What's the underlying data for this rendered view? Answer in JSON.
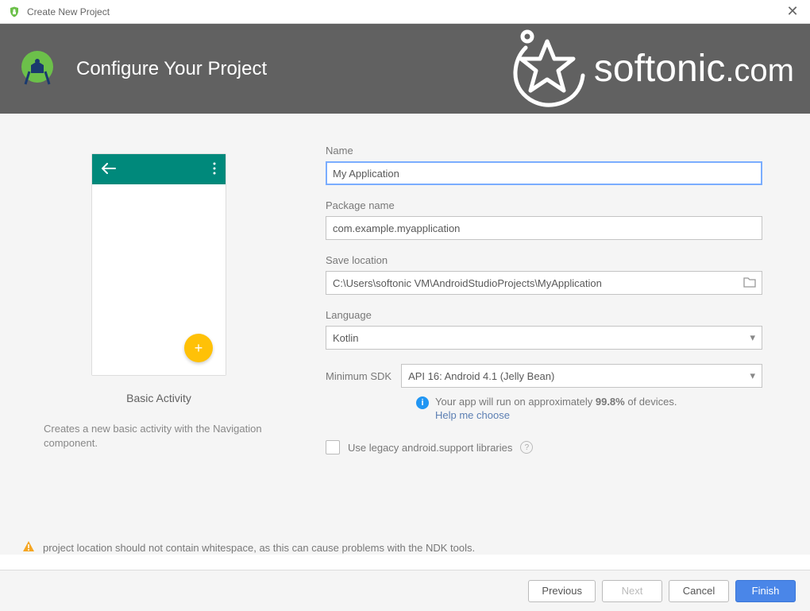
{
  "window": {
    "title": "Create New Project"
  },
  "header": {
    "title": "Configure Your Project"
  },
  "watermark": {
    "text": "softonic",
    "suffix": ".com"
  },
  "preview": {
    "activity_name": "Basic Activity",
    "description": "Creates a new basic activity with the Navigation component."
  },
  "form": {
    "name_label": "Name",
    "name_value": "My Application",
    "package_label": "Package name",
    "package_value": "com.example.myapplication",
    "location_label": "Save location",
    "location_value": "C:\\Users\\softonic VM\\AndroidStudioProjects\\MyApplication",
    "language_label": "Language",
    "language_value": "Kotlin",
    "sdk_label": "Minimum SDK",
    "sdk_value": "API 16: Android 4.1 (Jelly Bean)",
    "coverage_prefix": "Your app will run on approximately ",
    "coverage_percent": "99.8%",
    "coverage_suffix": " of devices.",
    "help_link": "Help me choose",
    "legacy_label": "Use legacy android.support libraries"
  },
  "warning": {
    "text": "project location should not contain whitespace, as this can cause problems with the NDK tools."
  },
  "buttons": {
    "previous": "Previous",
    "next": "Next",
    "cancel": "Cancel",
    "finish": "Finish"
  }
}
